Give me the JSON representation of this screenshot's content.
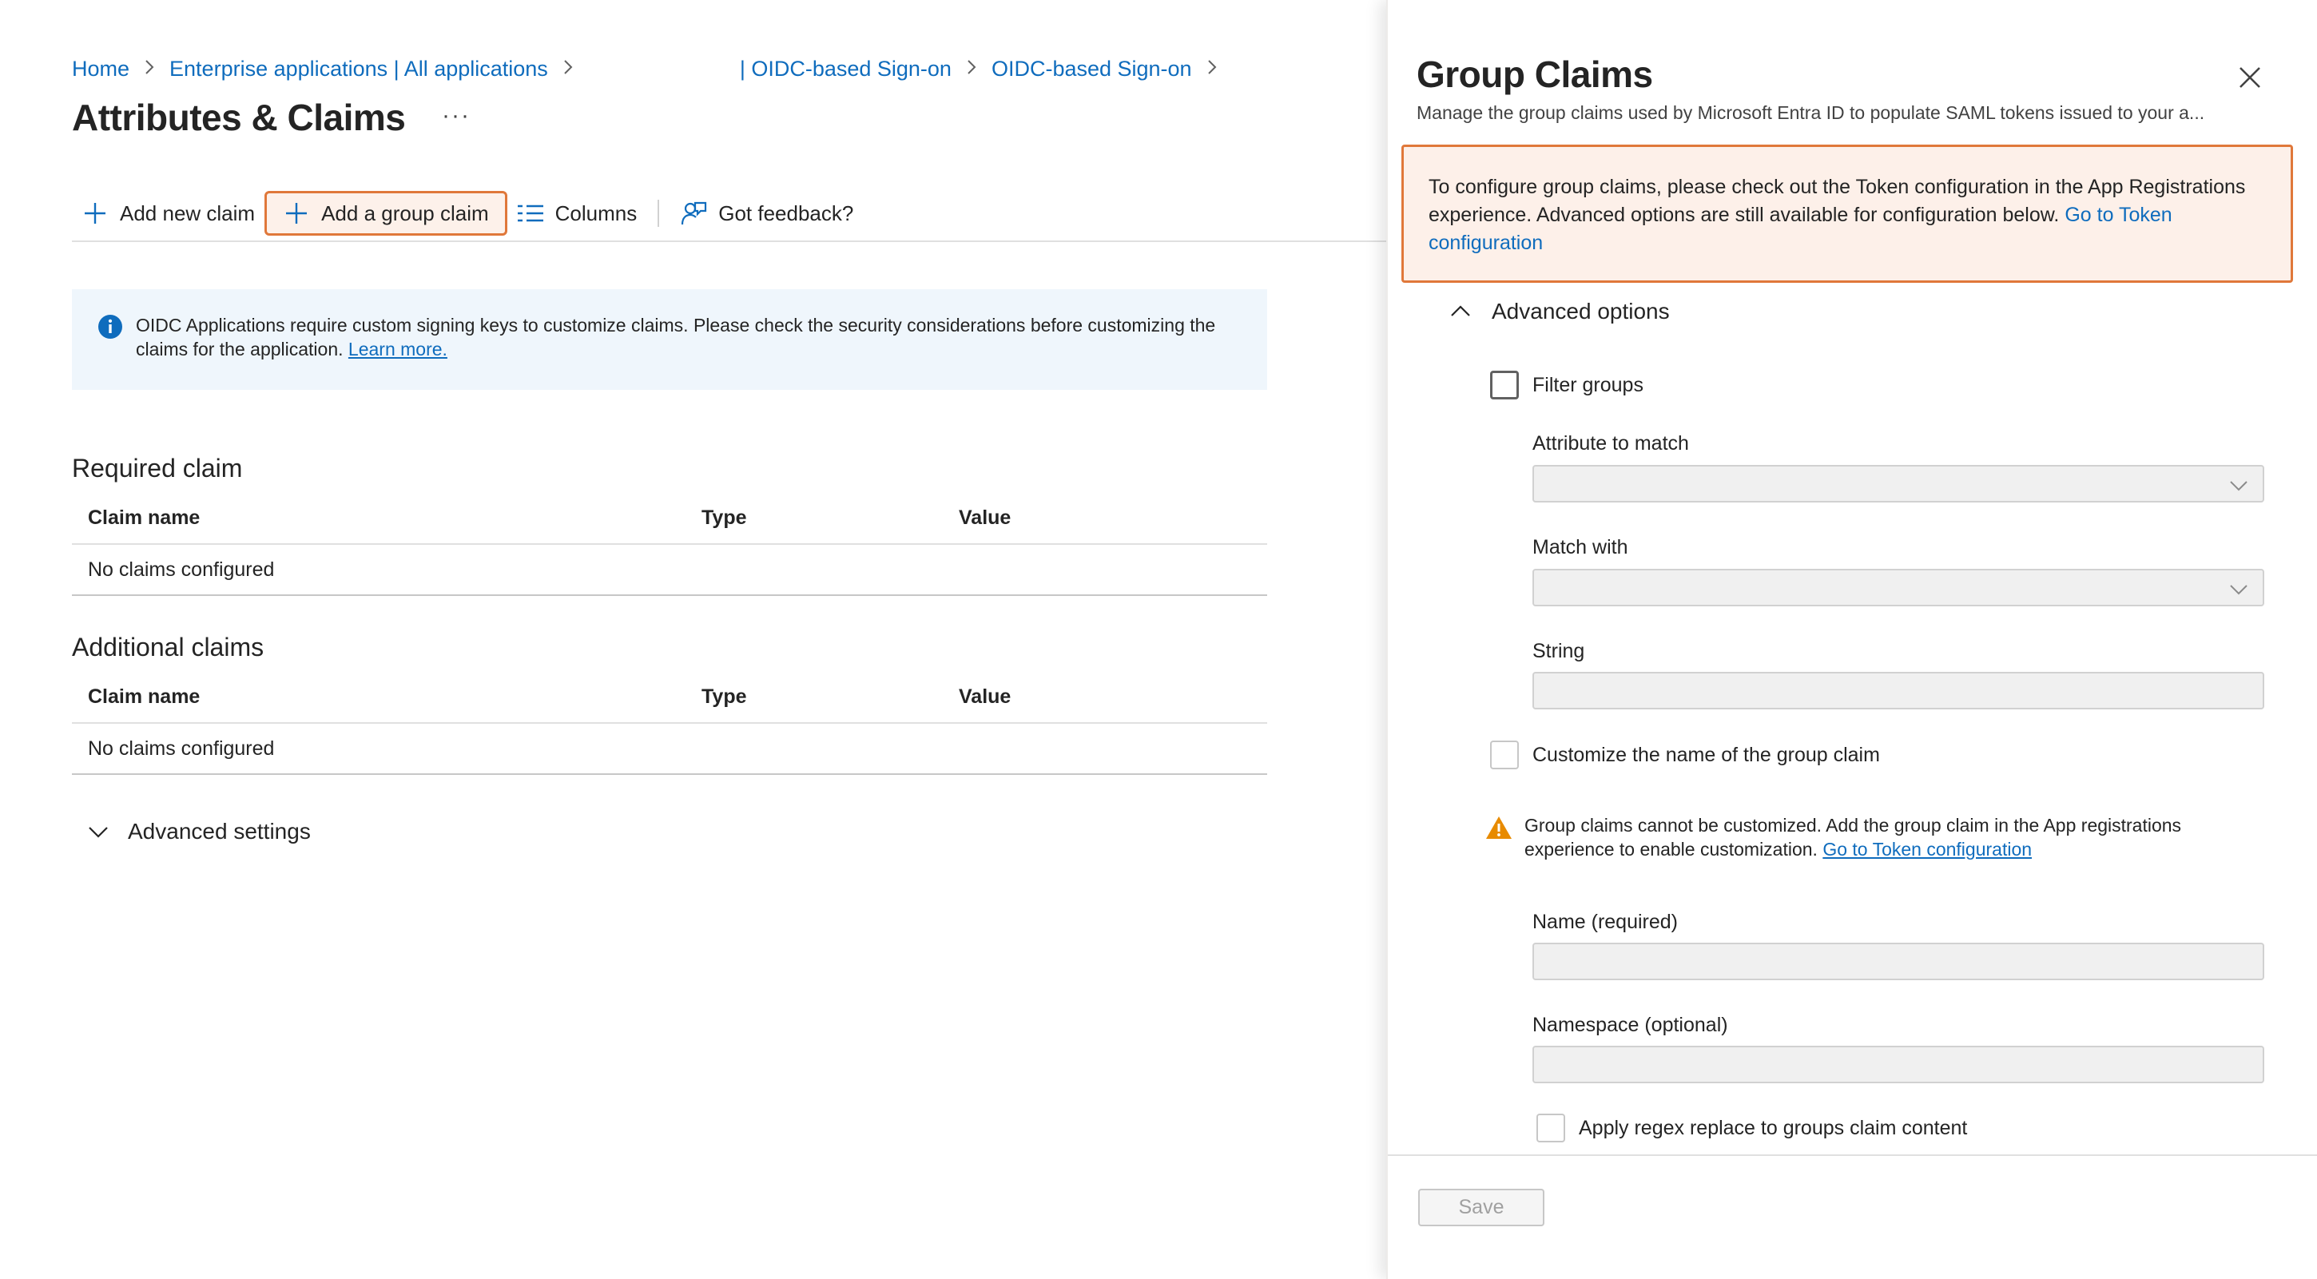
{
  "breadcrumb": {
    "home": "Home",
    "enterprise_apps": "Enterprise applications | All applications",
    "oidc1": "| OIDC-based Sign-on",
    "oidc2": "OIDC-based Sign-on",
    "separator": ">"
  },
  "page": {
    "title": "Attributes & Claims",
    "more": "···"
  },
  "toolbar": {
    "add_new_claim": "Add new claim",
    "add_group_claim": "Add a group claim",
    "columns": "Columns",
    "feedback": "Got feedback?"
  },
  "infobar": {
    "text": "OIDC Applications require custom signing keys to customize claims. Please check the security considerations before customizing the claims for the application.",
    "link": "Learn more."
  },
  "required": {
    "title": "Required claim",
    "columns": [
      "Claim name",
      "Type",
      "Value"
    ],
    "empty": "No claims configured"
  },
  "additional": {
    "title": "Additional claims",
    "columns": [
      "Claim name",
      "Type",
      "Value"
    ],
    "empty": "No claims configured"
  },
  "advanced_settings": "Advanced settings",
  "panel": {
    "title": "Group Claims",
    "subtitle": "Manage the group claims used by Microsoft Entra ID to populate SAML tokens issued to your a...",
    "warn_text": "To configure group claims, please check out the Token configuration in the App Registrations experience. Advanced options are still available for configuration below.",
    "warn_link": "Go to Token configuration",
    "advanced_options": "Advanced options",
    "filter_groups": "Filter groups",
    "attribute_to_match": "Attribute to match",
    "match_with": "Match with",
    "string": "String",
    "customize_name": "Customize the name of the group claim",
    "customize_warn_text": "Group claims cannot be customized. Add the group claim in the App registrations experience to enable customization.",
    "customize_warn_link": "Go to Token configuration",
    "name_required": "Name (required)",
    "namespace_optional": "Namespace (optional)",
    "apply_regex": "Apply regex replace to groups claim content",
    "save": "Save"
  },
  "colors": {
    "link": "#0f6cbd",
    "highlight_border": "#e0783a",
    "warning_icon": "#e88b00",
    "info_icon": "#0f6cbd"
  }
}
